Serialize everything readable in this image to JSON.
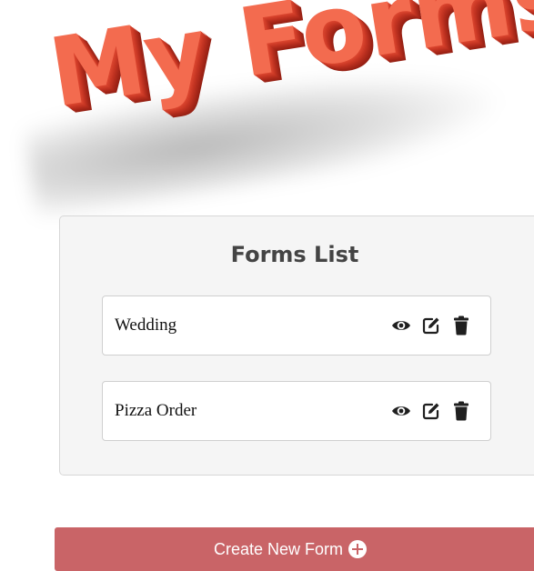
{
  "header": {
    "title": "My Forms"
  },
  "forms_list": {
    "title": "Forms List",
    "forms": [
      {
        "name": "Wedding",
        "actions": [
          "view-icon",
          "edit-icon",
          "delete-icon"
        ]
      },
      {
        "name": "Pizza Order",
        "actions": [
          "view-icon",
          "edit-icon",
          "delete-icon"
        ]
      }
    ]
  },
  "create_button": {
    "label": "Create New Form",
    "icon": "plus-circle-icon"
  },
  "colors": {
    "title_red": "#f36b4f",
    "button_bg": "#c96467",
    "card_bg": "#f5f5f5",
    "icon_color": "#1f1f1f"
  }
}
